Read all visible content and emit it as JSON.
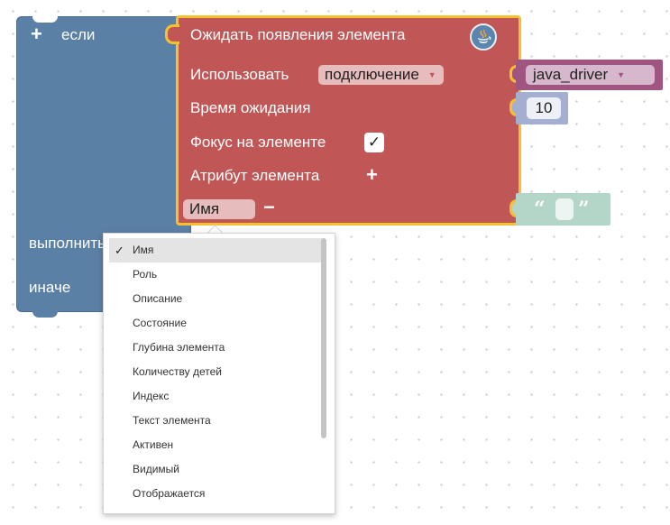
{
  "if_block": {
    "if_label": "если",
    "do_label": "выполнить",
    "else_label": "иначе"
  },
  "wait_block": {
    "title": "Ожидать появления элемента",
    "use_label": "Использовать",
    "connection_value": "подключение",
    "timeout_label": "Время ожидания",
    "focus_label": "Фокус на элементе",
    "focus_checked_glyph": "✓",
    "attribute_label": "Атрибут элемента",
    "attribute_value": "Имя"
  },
  "driver_block": {
    "value": "java_driver"
  },
  "number_block": {
    "value": "10"
  },
  "string_block": {
    "open_quote": "“",
    "close_quote": "”"
  },
  "icons": {
    "plus": "+",
    "minus": "−",
    "dropdown_arrow": "▼",
    "check": "✓"
  },
  "attribute_menu": {
    "selected_index": 0,
    "items": [
      "Имя",
      "Роль",
      "Описание",
      "Состояние",
      "Глубина элемента",
      "Количеству детей",
      "Индекс",
      "Текст элемента",
      "Активен",
      "Видимый",
      "Отображается"
    ]
  },
  "colors": {
    "logic_block": "#5b80a5",
    "wait_block": "#c15656",
    "selected_outline": "#f5c12e",
    "driver_block": "#a05480",
    "number_block": "#a4aed0",
    "string_block": "#b3d6c8"
  }
}
